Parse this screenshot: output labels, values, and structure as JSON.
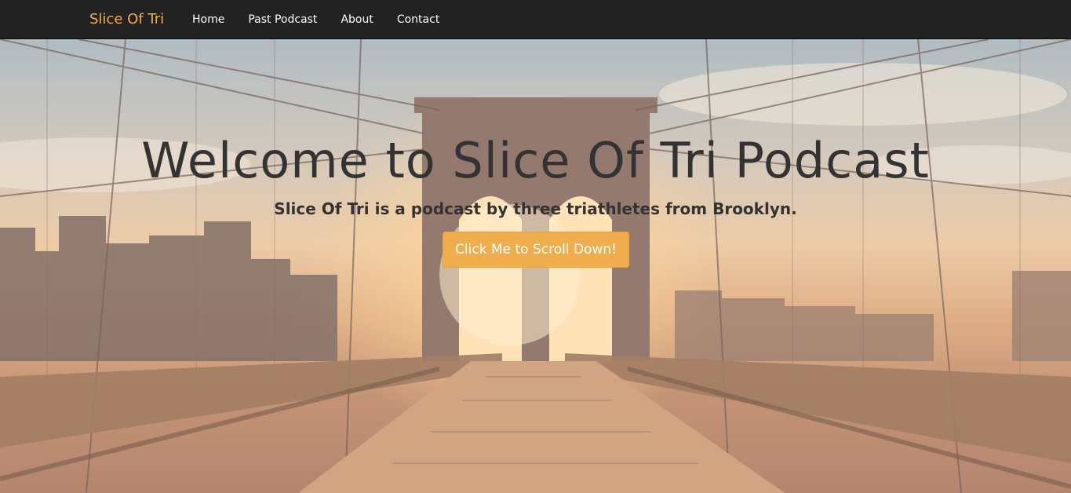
{
  "navbar": {
    "brand": "Slice Of Tri",
    "items": [
      {
        "label": "Home"
      },
      {
        "label": "Past Podcast"
      },
      {
        "label": "About"
      },
      {
        "label": "Contact"
      }
    ]
  },
  "hero": {
    "title": "Welcome to Slice Of Tri Podcast",
    "subtitle": "Slice Of Tri is a podcast by three triathletes from Brooklyn.",
    "button_label": "Click Me to Scroll Down!",
    "background_image": "brooklyn-bridge-sunset-photo"
  },
  "colors": {
    "navbar_bg": "#222222",
    "brand": "#f0ad4e",
    "nav_text": "#ffffff",
    "hero_text": "#333333",
    "button_bg": "#f0ad4e",
    "button_text": "#ffffff"
  }
}
